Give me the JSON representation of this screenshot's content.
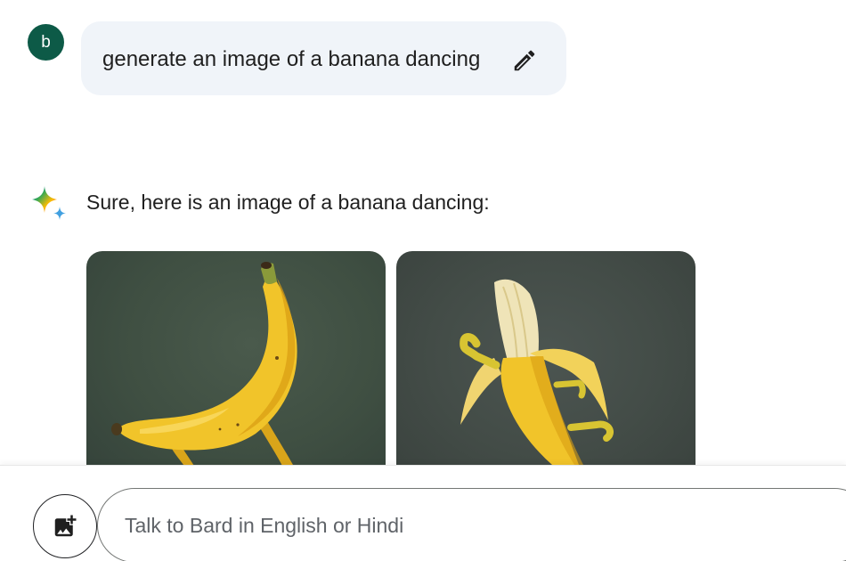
{
  "user_message": {
    "avatar_initial": "b",
    "text": "generate an image of a banana dancing",
    "edit_icon": "pencil-icon"
  },
  "response": {
    "icon": "sparkle-icon",
    "text": "Sure, here is an image of a banana dancing:",
    "images": [
      {
        "subject": "banana dancing on legs"
      },
      {
        "subject": "half-peeled banana with arms and legs"
      }
    ]
  },
  "composer": {
    "add_image_icon": "add-image-icon",
    "placeholder": "Talk to Bard in English or Hindi"
  },
  "colors": {
    "avatar": "#0d5a47",
    "user_bubble": "#f0f4f9",
    "banana_yellow": "#f3c623"
  }
}
